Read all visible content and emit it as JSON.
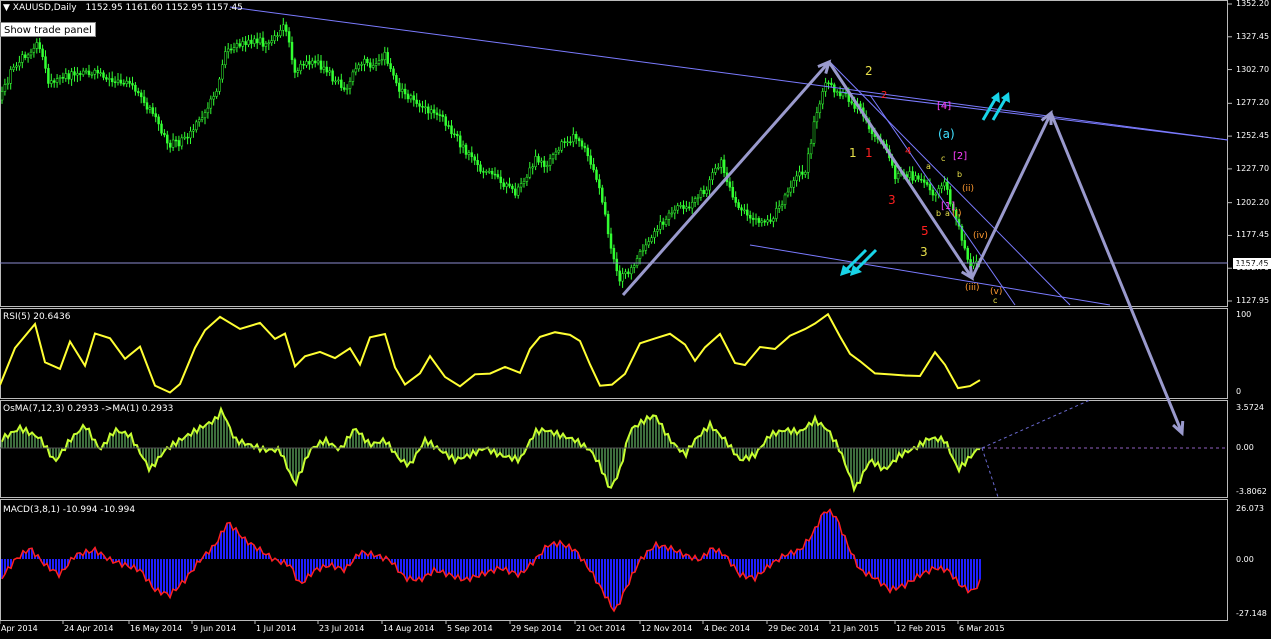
{
  "header": {
    "symbol_arrow": "▼",
    "title": "XAUUSD,Daily",
    "ohlc": "1152.95 1161.60 1152.95 1157.45"
  },
  "trade_panel_button": "Show trade panel",
  "price_tag": "1157.45",
  "price_axis": [
    "1352.20",
    "1327.45",
    "1302.70",
    "1277.20",
    "1252.45",
    "1227.70",
    "1202.20",
    "1177.45",
    "1152.70",
    "1127.95"
  ],
  "rsi": {
    "title": "RSI(5) 20.6436",
    "axis": [
      "100",
      "0"
    ]
  },
  "osma": {
    "title": "OsMA(7,12,3) 0.2933 ->MA(1) 0.2933",
    "axis": [
      "3.5724",
      "0.00",
      "-3.8062"
    ]
  },
  "macd": {
    "title": "MACD(3,8,1) -10.994 -10.994",
    "axis": [
      "26.073",
      "0.00",
      "-27.148"
    ]
  },
  "dates": [
    "Apr 2014",
    "24 Apr 2014",
    "16 May 2014",
    "9 Jun 2014",
    "1 Jul 2014",
    "23 Jul 2014",
    "14 Aug 2014",
    "5 Sep 2014",
    "29 Sep 2014",
    "21 Oct 2014",
    "12 Nov 2014",
    "4 Dec 2014",
    "29 Dec 2014",
    "21 Jan 2015",
    "12 Feb 2015",
    "6 Mar 2015"
  ],
  "wave_labels": [
    {
      "t": "2",
      "c": "#e8e04a"
    },
    {
      "t": "2",
      "c": "#ff2020"
    },
    {
      "t": "[4]",
      "c": "#ff40ff"
    },
    {
      "t": "(a)",
      "c": "#40e0ff"
    },
    {
      "t": "[2]",
      "c": "#ff40ff"
    },
    {
      "t": "1",
      "c": "#e8e04a"
    },
    {
      "t": "1",
      "c": "#ff2020"
    },
    {
      "t": "4",
      "c": "#ff2020"
    },
    {
      "t": "a",
      "c": "#e8e04a"
    },
    {
      "t": "c",
      "c": "#e8e04a"
    },
    {
      "t": "b",
      "c": "#e8e04a"
    },
    {
      "t": "(ii)",
      "c": "#ff9a30"
    },
    {
      "t": "3",
      "c": "#ff2020"
    },
    {
      "t": "b",
      "c": "#e8e04a"
    },
    {
      "t": "a",
      "c": "#e8e04a"
    },
    {
      "t": "(i)",
      "c": "#ff9a30"
    },
    {
      "t": "5",
      "c": "#ff2020"
    },
    {
      "t": "[1]",
      "c": "#ff40ff"
    },
    {
      "t": "(iv)",
      "c": "#ff9a30"
    },
    {
      "t": "3",
      "c": "#e8e04a"
    },
    {
      "t": "(iii)",
      "c": "#ff9a30"
    },
    {
      "t": "(v)",
      "c": "#ff9a30"
    },
    {
      "t": "c",
      "c": "#e8e04a"
    }
  ],
  "colors": {
    "up_candle": "#33ff33",
    "rsi_line": "#ffff33",
    "osma_bar": "#3d6e3d",
    "osma_line": "#c8ff30",
    "macd_bar": "#2020ff",
    "macd_line": "#ff2020",
    "trendline": "#7b7bff",
    "projection": "#9a9acd",
    "signal_arrow": "#18d4e8"
  },
  "chart_data": {
    "type": "candlestick",
    "symbol": "XAUUSD",
    "timeframe": "Daily",
    "last_close": 1157.45,
    "ylim": [
      1127.95,
      1352.2
    ],
    "x": [
      "Apr 2014",
      "24 Apr 2014",
      "16 May 2014",
      "9 Jun 2014",
      "1 Jul 2014",
      "23 Jul 2014",
      "14 Aug 2014",
      "5 Sep 2014",
      "29 Sep 2014",
      "21 Oct 2014",
      "12 Nov 2014",
      "4 Dec 2014",
      "29 Dec 2014",
      "21 Jan 2015",
      "12 Feb 2015",
      "6 Mar 2015"
    ],
    "close": [
      1295,
      1300,
      1290,
      1260,
      1322,
      1305,
      1310,
      1275,
      1215,
      1225,
      1180,
      1200,
      1185,
      1290,
      1225,
      1160
    ],
    "series": [
      {
        "name": "RSI(5)",
        "last": 20.6436,
        "ylim": [
          0,
          100
        ]
      },
      {
        "name": "OsMA(7,12,3)",
        "last": 0.2933,
        "ylim": [
          -3.8062,
          3.5724
        ]
      },
      {
        "name": "MACD(3,8,1)",
        "last": -10.994,
        "ylim": [
          -27.148,
          26.073
        ]
      }
    ]
  }
}
